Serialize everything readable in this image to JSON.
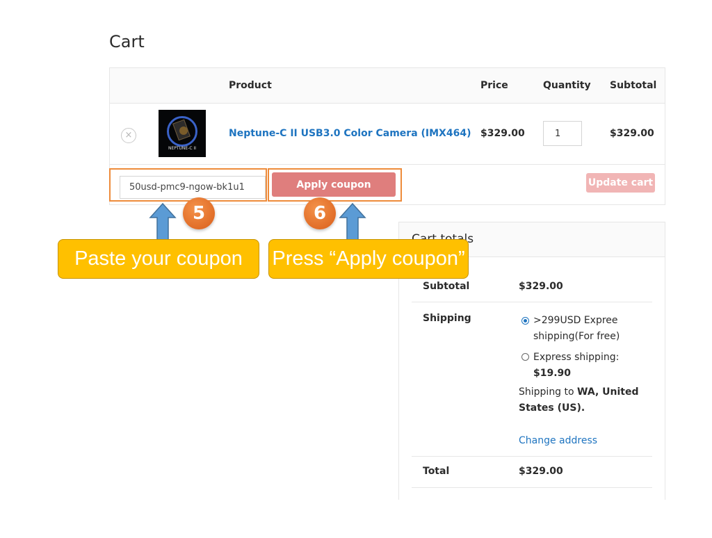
{
  "page": {
    "title": "Cart"
  },
  "table": {
    "headers": {
      "product": "Product",
      "price": "Price",
      "quantity": "Quantity",
      "subtotal": "Subtotal"
    },
    "items": [
      {
        "remove": "×",
        "thumb_text": "NEPTUNE-C II",
        "name": "Neptune-C II USB3.0 Color Camera (IMX464)",
        "price": "$329.00",
        "quantity": "1",
        "subtotal": "$329.00"
      }
    ]
  },
  "coupon": {
    "value": "50usd-pmc9-ngow-bk1u1",
    "apply_label": "Apply coupon",
    "update_label": "Update cart"
  },
  "annotations": {
    "step5": {
      "number": "5",
      "text": "Paste your coupon"
    },
    "step6": {
      "number": "6",
      "text": "Press “Apply coupon”"
    },
    "color": "#ffc000",
    "badge_color": "#e8722c"
  },
  "totals": {
    "title": "Cart totals",
    "subtotal_label": "Subtotal",
    "subtotal_value": "$329.00",
    "shipping_label": "Shipping",
    "options": [
      {
        "line1": ">299USD Expree",
        "line2": "shipping(For free)",
        "selected": true
      },
      {
        "line1": "Express shipping:",
        "line2": "$19.90",
        "selected": false
      }
    ],
    "shipping_to_prefix": "Shipping to",
    "shipping_to_place": "WA, United",
    "shipping_to_place2": "States (US).",
    "change_address": "Change address",
    "total_label": "Total",
    "total_value": "$329.00"
  },
  "colors": {
    "link": "#1e74c0",
    "apply_button": "#df7e7d",
    "update_button": "#f1b5b5"
  }
}
